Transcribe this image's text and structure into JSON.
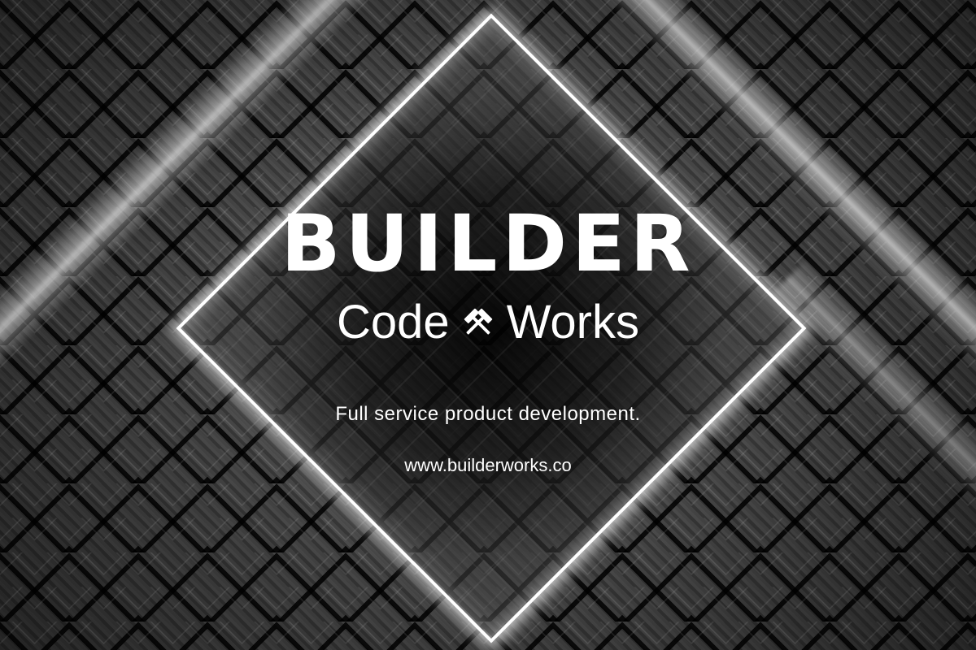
{
  "brand": {
    "title": "BUILDER",
    "sub_left": "Code",
    "sub_right": "Works",
    "logo_icon": "crossed-hammers-icon"
  },
  "tagline": "Full service product development.",
  "website": "www.builderworks.co",
  "colors": {
    "text": "#ffffff",
    "background": "#2a2a2a",
    "glow": "#ffffff"
  }
}
